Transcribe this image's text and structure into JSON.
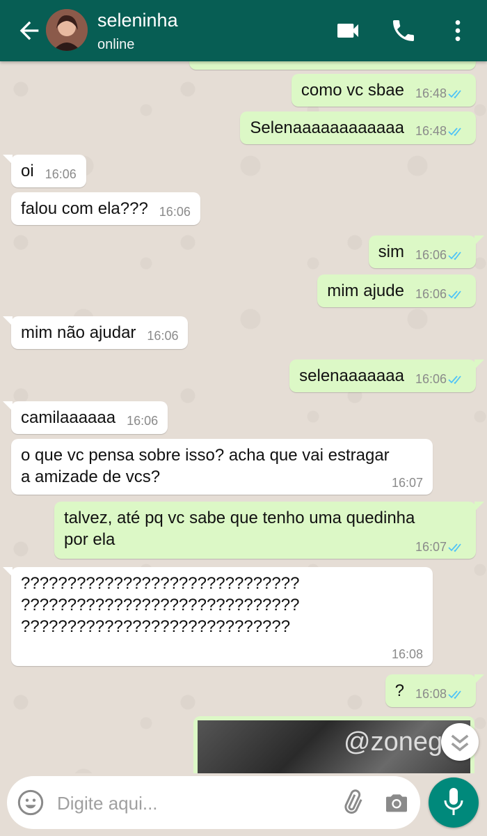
{
  "header": {
    "contact_name": "seleninha",
    "status": "online",
    "colors": {
      "bar": "#075e54",
      "outgoing": "#dcf8c6",
      "incoming": "#ffffff",
      "tick_read": "#4fc3f7"
    }
  },
  "messages": [
    {
      "dir": "out",
      "text": "como vc sbae",
      "time": "16:48",
      "read": true
    },
    {
      "dir": "out",
      "text": "Selenaaaaaaaaaaaa",
      "time": "16:48",
      "read": true
    },
    {
      "dir": "in",
      "text": "oi",
      "time": "16:06"
    },
    {
      "dir": "in",
      "text": "falou com ela???",
      "time": "16:06"
    },
    {
      "dir": "out",
      "text": "sim",
      "time": "16:06",
      "read": true
    },
    {
      "dir": "out",
      "text": "mim ajude",
      "time": "16:06",
      "read": true
    },
    {
      "dir": "in",
      "text": "mim não ajudar",
      "time": "16:06"
    },
    {
      "dir": "out",
      "text": "selenaaaaaaa",
      "time": "16:06",
      "read": true
    },
    {
      "dir": "in",
      "text": "camilaaaaaa",
      "time": "16:06"
    },
    {
      "dir": "in",
      "text": "o que vc pensa sobre isso? acha que vai estragar\na amizade de vcs?",
      "time": "16:07"
    },
    {
      "dir": "out",
      "text": "talvez, até pq vc sabe que tenho uma quedinha\npor ela",
      "time": "16:07",
      "read": true
    },
    {
      "dir": "in",
      "text": "??????????????????????????????\n??????????????????????????????\n?????????????????????????????",
      "time": "16:08"
    },
    {
      "dir": "out",
      "text": "?",
      "time": "16:08",
      "read": true
    }
  ],
  "image_message": {
    "watermark": "@zoneg"
  },
  "input": {
    "placeholder": "Digite aqui..."
  },
  "icons": [
    "back-arrow-icon",
    "video-call-icon",
    "phone-icon",
    "more-vert-icon",
    "emoji-icon",
    "paperclip-icon",
    "camera-icon",
    "microphone-icon",
    "scroll-down-icon",
    "double-check-icon"
  ]
}
